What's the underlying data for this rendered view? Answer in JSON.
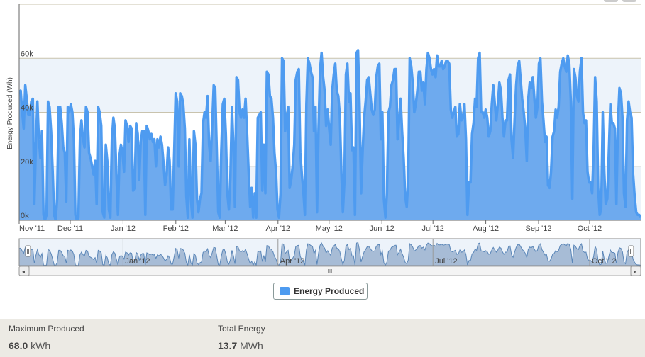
{
  "chart_data": {
    "type": "area",
    "title": "",
    "xlabel": "",
    "ylabel": "Energy Produced (Wh)",
    "ylim": [
      0,
      80000
    ],
    "y_ticks": [
      {
        "value": 0,
        "label": "0k"
      },
      {
        "value": 20000,
        "label": "20k"
      },
      {
        "value": 40000,
        "label": "40k"
      },
      {
        "value": 60000,
        "label": "60k"
      }
    ],
    "x_range": [
      "2011-11-01",
      "2012-10-31"
    ],
    "x_ticks": [
      {
        "day": 0,
        "label": "Nov '11"
      },
      {
        "day": 30,
        "label": "Dec '11"
      },
      {
        "day": 61,
        "label": "Jan '12"
      },
      {
        "day": 92,
        "label": "Feb '12"
      },
      {
        "day": 121,
        "label": "Mar '12"
      },
      {
        "day": 152,
        "label": "Apr '12"
      },
      {
        "day": 182,
        "label": "May '12"
      },
      {
        "day": 213,
        "label": "Jun '12"
      },
      {
        "day": 243,
        "label": "Jul '12"
      },
      {
        "day": 274,
        "label": "Aug '12"
      },
      {
        "day": 305,
        "label": "Sep '12"
      },
      {
        "day": 335,
        "label": "Oct '12"
      }
    ],
    "navigator_ticks": [
      {
        "day": 61,
        "label": "Jan '12"
      },
      {
        "day": 152,
        "label": "Apr '12"
      },
      {
        "day": 243,
        "label": "Jul '12"
      },
      {
        "day": 335,
        "label": "Oct '12"
      }
    ],
    "grid": true,
    "legend": {
      "position": "bottom-center",
      "entries": [
        "Energy Produced"
      ]
    },
    "series": [
      {
        "name": "Energy Produced",
        "color": "#4e9bf0",
        "unit": "Wh",
        "values_kwh": [
          47,
          48,
          40,
          34,
          50,
          45,
          39,
          39,
          44,
          45,
          6,
          28,
          44,
          30,
          23,
          33,
          2,
          0,
          2,
          44,
          42,
          33,
          19,
          2,
          0,
          8,
          42,
          42,
          36,
          27,
          25,
          7,
          42,
          40,
          43,
          40,
          30,
          2,
          0,
          1,
          30,
          37,
          30,
          27,
          42,
          40,
          25,
          23,
          20,
          17,
          22,
          6,
          42,
          40,
          35,
          3,
          1,
          28,
          22,
          4,
          1,
          30,
          38,
          34,
          17,
          2,
          24,
          28,
          25,
          18,
          37,
          35,
          29,
          35,
          34,
          11,
          12,
          36,
          32,
          15,
          29,
          33,
          33,
          2,
          35,
          33,
          30,
          32,
          29,
          30,
          20,
          30,
          27,
          31,
          28,
          21,
          13,
          17,
          27,
          22,
          4,
          4,
          25,
          47,
          44,
          20,
          47,
          46,
          43,
          34,
          9,
          1,
          30,
          8,
          1,
          33,
          28,
          8,
          3,
          8,
          10,
          36,
          40,
          38,
          46,
          28,
          22,
          35,
          50,
          49,
          27,
          3,
          1,
          26,
          43,
          45,
          32,
          10,
          4,
          16,
          42,
          27,
          5,
          53,
          52,
          40,
          38,
          41,
          38,
          45,
          32,
          18,
          5,
          12,
          1,
          10,
          1,
          38,
          39,
          40,
          11,
          28,
          10,
          55,
          54,
          46,
          45,
          38,
          25,
          18,
          4,
          1,
          10,
          60,
          59,
          33,
          38,
          42,
          12,
          15,
          20,
          28,
          52,
          55,
          56,
          25,
          17,
          11,
          2,
          43,
          60,
          58,
          55,
          53,
          33,
          42,
          3,
          34,
          56,
          62,
          53,
          48,
          35,
          41,
          34,
          28,
          48,
          54,
          58,
          48,
          46,
          39,
          18,
          3,
          14,
          54,
          58,
          44,
          47,
          26,
          27,
          2,
          62,
          63,
          42,
          10,
          25,
          38,
          44,
          52,
          53,
          47,
          41,
          39,
          41,
          53,
          57,
          58,
          30,
          40,
          8,
          1,
          10,
          40,
          42,
          50,
          52,
          56,
          56,
          30,
          37,
          45,
          33,
          23,
          9,
          5,
          15,
          60,
          57,
          51,
          40,
          43,
          48,
          55,
          55,
          48,
          51,
          43,
          56,
          62,
          60,
          56,
          54,
          56,
          53,
          61,
          57,
          57,
          59,
          56,
          57,
          59,
          59,
          58,
          41,
          38,
          40,
          42,
          31,
          32,
          43,
          37,
          38,
          43,
          30,
          2,
          14,
          14,
          32,
          36,
          45,
          42,
          60,
          62,
          40,
          40,
          38,
          41,
          38,
          31,
          33,
          43,
          50,
          43,
          37,
          43,
          51,
          48,
          38,
          31,
          37,
          37,
          52,
          54,
          30,
          23,
          37,
          50,
          57,
          59,
          52,
          45,
          40,
          34,
          22,
          45,
          51,
          49,
          53,
          45,
          38,
          42,
          58,
          60,
          44,
          37,
          29,
          31,
          13,
          12,
          18,
          31,
          33,
          41,
          38,
          42,
          55,
          58,
          60,
          57,
          55,
          61,
          58,
          44,
          8,
          56,
          53,
          46,
          44,
          55,
          60,
          40,
          36,
          37,
          18,
          14,
          14,
          10,
          25,
          53,
          44,
          12,
          2,
          4,
          40,
          18,
          6,
          8,
          25,
          43,
          36,
          36,
          34,
          6,
          36,
          49,
          47,
          38,
          10,
          5,
          37,
          44,
          40,
          38,
          17,
          9,
          3,
          2,
          2,
          1
        ]
      }
    ],
    "navigator": {
      "range_start": "2011-11-01",
      "range_end": "2012-10-31",
      "handle_left_icon": "drag-handle-icon",
      "handle_right_icon": "drag-handle-icon"
    }
  },
  "legend": {
    "label": "Energy Produced",
    "color": "#4e9bf0"
  },
  "stats": {
    "maximum": {
      "label": "Maximum Produced",
      "value": "68.0",
      "unit": "kWh"
    },
    "total": {
      "label": "Total Energy",
      "value": "13.7",
      "unit": "MWh"
    }
  },
  "scrollbar": {
    "left_arrow": "◂",
    "right_arrow": "▸",
    "grip": "III"
  }
}
